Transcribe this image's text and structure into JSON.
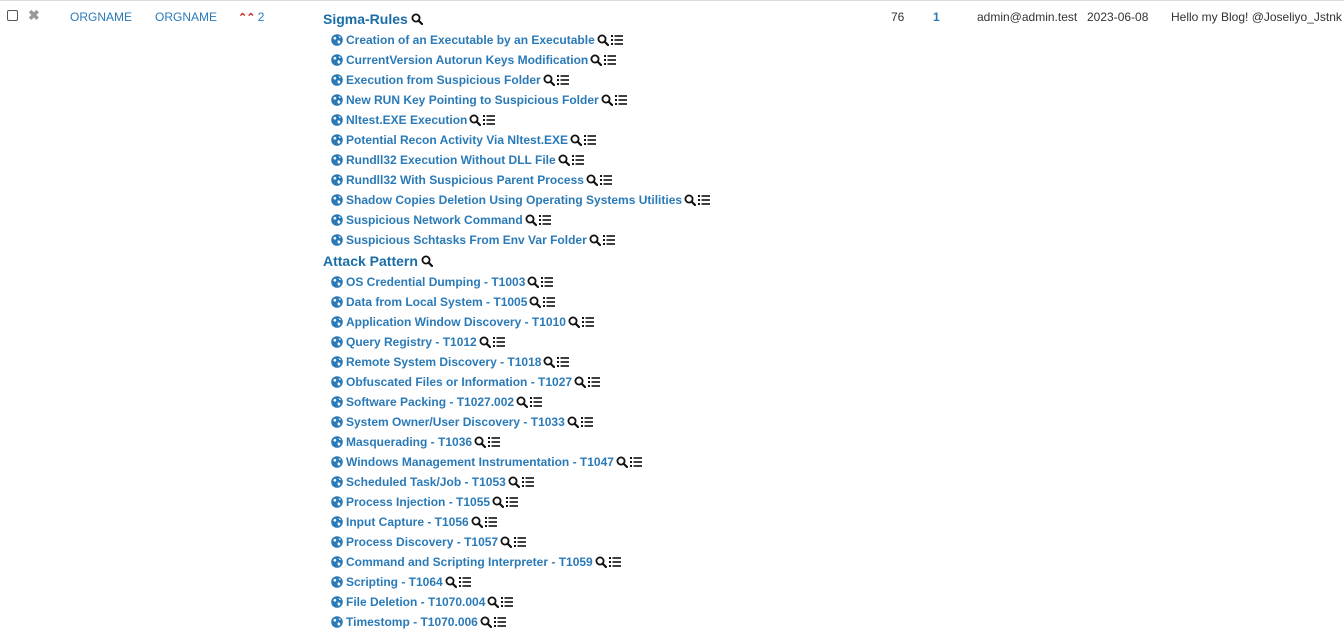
{
  "row": {
    "org_name": "ORGNAME",
    "owner_org_name": "ORGNAME",
    "threat_level_value": "2",
    "attribute_count": "76",
    "correlation_count": "1",
    "creator": "admin@admin.test",
    "date": "2023-06-08",
    "info": "Hello my Blog! @Joseliyo_Jstnk",
    "colors": {
      "link": "#2a7ab8",
      "threat_chevron": "#cc1f1f",
      "delete": "#999999"
    }
  },
  "clusters": [
    {
      "title": "Sigma-Rules",
      "items": [
        "Creation of an Executable by an Executable",
        "CurrentVersion Autorun Keys Modification",
        "Execution from Suspicious Folder",
        "New RUN Key Pointing to Suspicious Folder",
        "Nltest.EXE Execution",
        "Potential Recon Activity Via Nltest.EXE",
        "Rundll32 Execution Without DLL File",
        "Rundll32 With Suspicious Parent Process",
        "Shadow Copies Deletion Using Operating Systems Utilities",
        "Suspicious Network Command",
        "Suspicious Schtasks From Env Var Folder"
      ]
    },
    {
      "title": "Attack Pattern",
      "items": [
        "OS Credential Dumping - T1003",
        "Data from Local System - T1005",
        "Application Window Discovery - T1010",
        "Query Registry - T1012",
        "Remote System Discovery - T1018",
        "Obfuscated Files or Information - T1027",
        "Software Packing - T1027.002",
        "System Owner/User Discovery - T1033",
        "Masquerading - T1036",
        "Windows Management Instrumentation - T1047",
        "Scheduled Task/Job - T1053",
        "Process Injection - T1055",
        "Input Capture - T1056",
        "Process Discovery - T1057",
        "Command and Scripting Interpreter - T1059",
        "Scripting - T1064",
        "File Deletion - T1070.004",
        "Timestomp - T1070.006"
      ]
    }
  ],
  "icons": {
    "cluster_item": "globe-icon",
    "search": "search-icon",
    "list": "list-icon",
    "delete": "close-icon",
    "threat": "double-chevron-up-icon"
  }
}
